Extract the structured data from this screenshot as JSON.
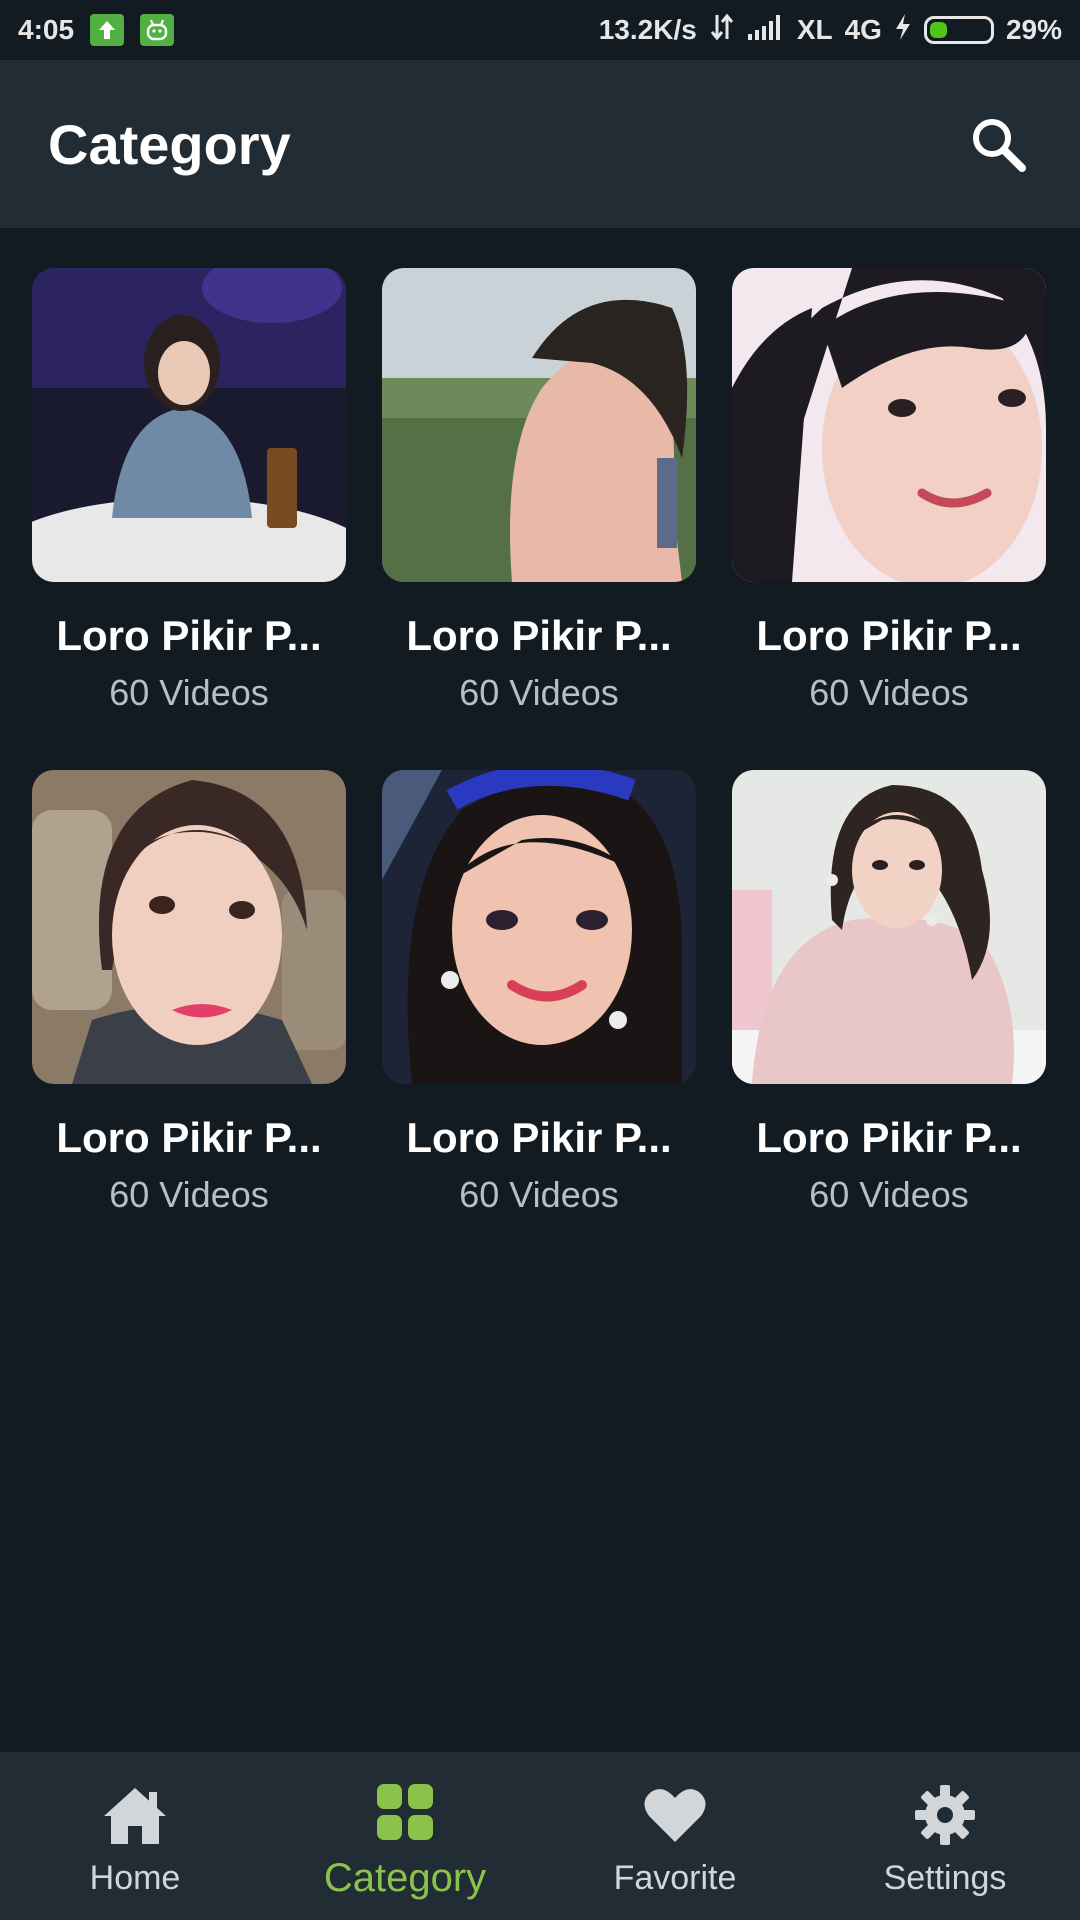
{
  "status_bar": {
    "time": "4:05",
    "net_speed": "13.2K/s",
    "carrier": "XL",
    "network": "4G",
    "battery": "29%",
    "battery_level": 0.29,
    "icons": [
      "upload-icon",
      "android-icon",
      "data-arrows-icon",
      "signal-icon",
      "charging-icon",
      "battery-icon"
    ]
  },
  "header": {
    "title": "Category",
    "search_icon": "search-icon"
  },
  "categories": [
    {
      "title": "Loro Pikir P...",
      "count": "60 Videos"
    },
    {
      "title": "Loro Pikir P...",
      "count": "60 Videos"
    },
    {
      "title": "Loro Pikir P...",
      "count": "60 Videos"
    },
    {
      "title": "Loro Pikir P...",
      "count": "60 Videos"
    },
    {
      "title": "Loro Pikir P...",
      "count": "60 Videos"
    },
    {
      "title": "Loro Pikir P...",
      "count": "60 Videos"
    }
  ],
  "bottom_nav": {
    "items": [
      {
        "label": "Home",
        "icon": "home-icon",
        "active": false
      },
      {
        "label": "Category",
        "icon": "grid-icon",
        "active": true
      },
      {
        "label": "Favorite",
        "icon": "heart-icon",
        "active": false
      },
      {
        "label": "Settings",
        "icon": "gear-icon",
        "active": false
      }
    ],
    "active_color": "#8bc34a",
    "inactive_color": "#d2d6d9"
  },
  "colors": {
    "background": "#121b22",
    "bar": "#212c35",
    "accent": "#8bc34a"
  }
}
